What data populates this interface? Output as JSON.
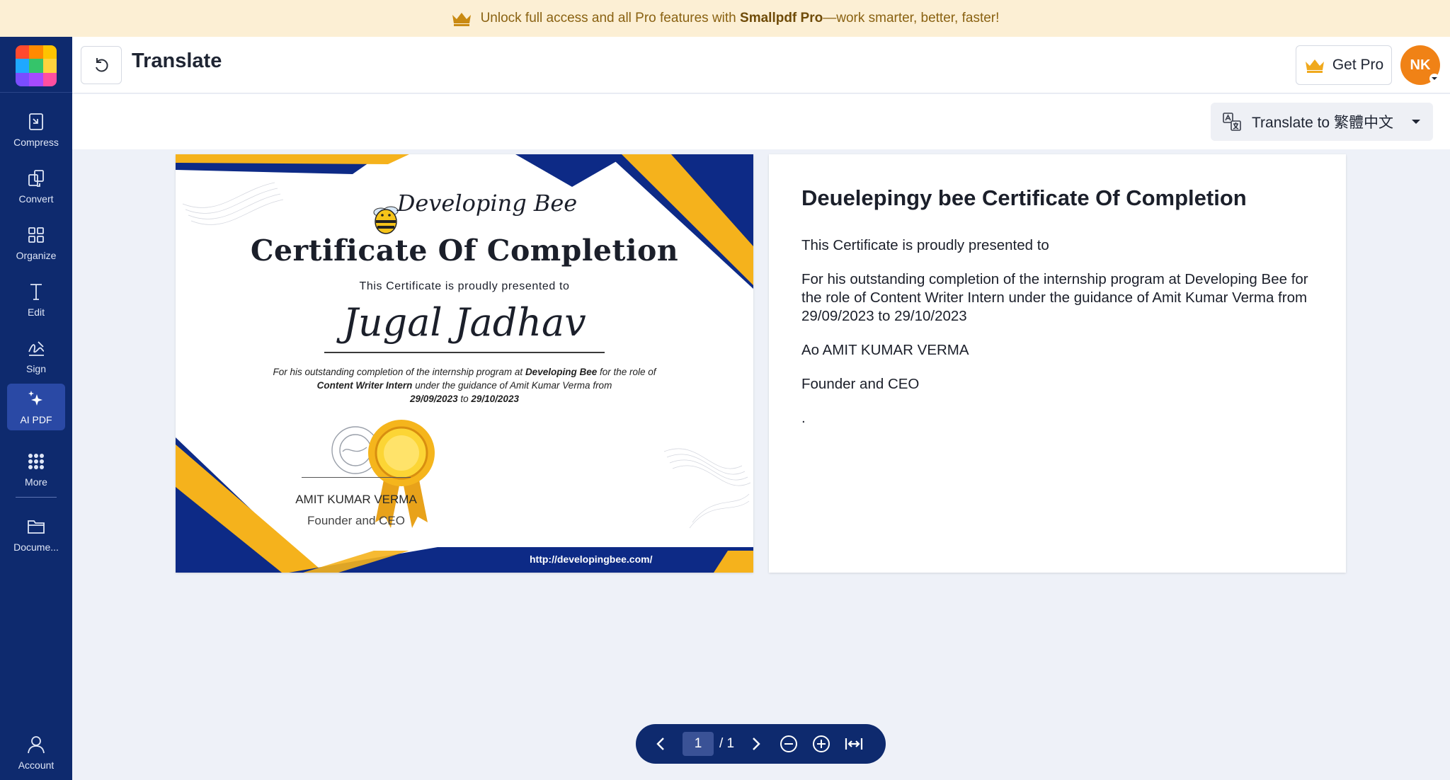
{
  "promo": {
    "text_before": "Unlock full access and all Pro features with",
    "brand": "Smallpdf Pro",
    "text_after": "—work smarter, better, faster!"
  },
  "sidebar": {
    "items": [
      {
        "label": "Compress",
        "icon": "compress-icon"
      },
      {
        "label": "Convert",
        "icon": "convert-icon"
      },
      {
        "label": "Organize",
        "icon": "organize-icon"
      },
      {
        "label": "Edit",
        "icon": "edit-icon"
      },
      {
        "label": "Sign",
        "icon": "sign-icon"
      },
      {
        "label": "AI PDF",
        "icon": "sparkle-icon",
        "active": true
      },
      {
        "label": "More",
        "icon": "more-grid-icon"
      },
      {
        "label": "Docume...",
        "icon": "folder-icon"
      },
      {
        "label": "Account",
        "icon": "account-icon"
      }
    ]
  },
  "header": {
    "title": "Translate",
    "get_pro_label": "Get Pro",
    "avatar_initials": "NK"
  },
  "toolbar": {
    "translate_label": "Translate to 繁體中文"
  },
  "original_doc": {
    "brand": "Developing Bee",
    "title": "Certificate Of Completion",
    "presented": "This Certificate is proudly presented to",
    "name": "Jugal Jadhav",
    "body_1": "For his outstanding completion of the internship program at",
    "body_company": "Developing Bee",
    "body_2": "for the role of",
    "body_role": "Content Writer Intern",
    "body_3": "under the guidance of Amit Kumar Verma from",
    "body_dates_start": "29/09/2023",
    "body_to": "to",
    "body_dates_end": "29/10/2023",
    "signer": "AMIT KUMAR VERMA",
    "signer_role": "Founder and CEO",
    "url": "http://developingbee.com/"
  },
  "translated_doc": {
    "title": "Deuelepingy bee Certificate Of Completion",
    "lines": [
      "This Certificate is proudly presented to",
      "For his outstanding completion of the internship program at Developing Bee for the role of Content Writer Intern under the guidance of Amit Kumar Verma from 29/09/2023 to 29/10/2023",
      "Ao AMIT KUMAR VERMA",
      "Founder and CEO",
      "."
    ]
  },
  "pager": {
    "current_page": "1",
    "total": "/ 1"
  },
  "colors": {
    "sidebar": "#0e2a6e",
    "active_nav": "#2a49a5",
    "banner": "#fcefd4",
    "avatar": "#f08216",
    "cert_navy": "#0d2a86",
    "cert_gold": "#f5b21c"
  }
}
